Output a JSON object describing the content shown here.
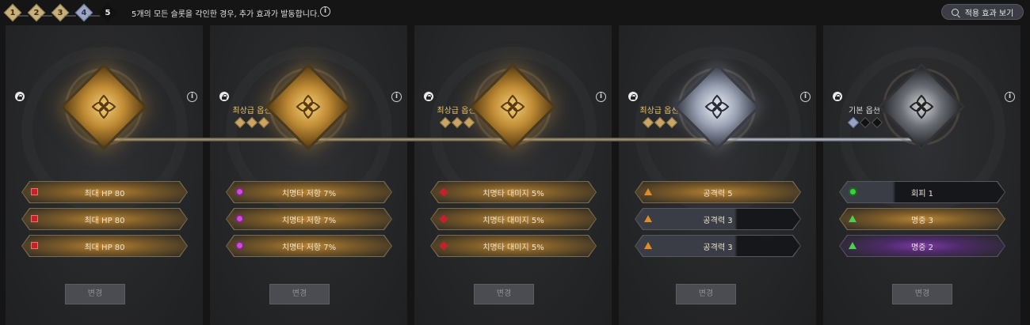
{
  "header": {
    "steps": [
      "1",
      "2",
      "3",
      "4",
      "5"
    ],
    "notice": "5개의 모든 슬롯을 각인한 경우, 추가 효과가 발동합니다.",
    "effects_button_label": "적용 효과 보기"
  },
  "panels": [
    {
      "grade_label": "",
      "grade_dots": [],
      "options": [
        {
          "text": "최대 HP 80",
          "style": "gold",
          "icon": "red-square-icon"
        },
        {
          "text": "최대 HP 80",
          "style": "gold",
          "icon": "red-square-icon"
        },
        {
          "text": "최대 HP 80",
          "style": "gold",
          "icon": "red-square-icon"
        }
      ],
      "change_label": "변경"
    },
    {
      "grade_label": "최상급 옵션",
      "grade_dots": [
        "gold",
        "gold",
        "gold"
      ],
      "options": [
        {
          "text": "치명타 저항 7%",
          "style": "gold",
          "icon": "pink-gem-icon"
        },
        {
          "text": "치명타 저항 7%",
          "style": "gold",
          "icon": "pink-gem-icon"
        },
        {
          "text": "치명타 저항 7%",
          "style": "gold",
          "icon": "pink-gem-icon"
        }
      ],
      "change_label": "변경"
    },
    {
      "grade_label": "최상급 옵션",
      "grade_dots": [
        "gold",
        "gold",
        "gold"
      ],
      "options": [
        {
          "text": "치명타 대미지 5%",
          "style": "gold",
          "icon": "red-diamond-icon"
        },
        {
          "text": "치명타 대미지 5%",
          "style": "gold",
          "icon": "red-diamond-icon"
        },
        {
          "text": "치명타 대미지 5%",
          "style": "gold",
          "icon": "red-diamond-icon"
        }
      ],
      "change_label": "변경"
    },
    {
      "grade_label": "최상급 옵션",
      "grade_dots": [
        "gold",
        "gold",
        "gold"
      ],
      "options": [
        {
          "text": "공격력 5",
          "style": "gold",
          "icon": "orange-triangle-icon"
        },
        {
          "text": "공격력 3",
          "style": "black",
          "icon": "orange-triangle-icon"
        },
        {
          "text": "공격력 3",
          "style": "black",
          "icon": "orange-triangle-icon"
        }
      ],
      "change_label": "변경"
    },
    {
      "grade_label": "기본 옵션",
      "grade_dots": [
        "blue",
        "black",
        "black"
      ],
      "options": [
        {
          "text": "회피 1",
          "style": "black2",
          "icon": "green-circle-icon"
        },
        {
          "text": "명중 3",
          "style": "gold",
          "icon": "green-triangle-icon"
        },
        {
          "text": "명중 2",
          "style": "purple",
          "icon": "green-triangle-icon"
        }
      ],
      "change_label": "변경"
    }
  ],
  "colors": {
    "gold_accent": "#e8c46a",
    "background": "#151515",
    "panel": "#2a2b2e"
  }
}
